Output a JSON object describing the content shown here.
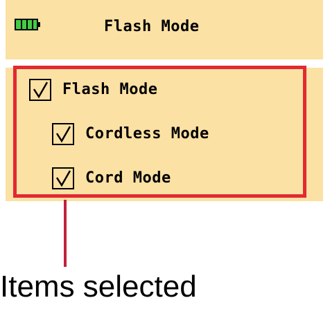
{
  "header": {
    "title": "Flash Mode",
    "battery_icon": "battery-icon"
  },
  "list": {
    "items": [
      {
        "label": "Flash Mode",
        "checked": true,
        "icon": "checkbox-checked-icon"
      },
      {
        "label": "Cordless Mode",
        "checked": true,
        "icon": "checkbox-checked-icon"
      },
      {
        "label": "Cord Mode",
        "checked": true,
        "icon": "checkbox-checked-icon"
      }
    ]
  },
  "callout": {
    "text": "Items selected"
  },
  "colors": {
    "panel_background": "#fce1a4",
    "highlight": "#e12a31",
    "battery_green": "#44cc44"
  }
}
